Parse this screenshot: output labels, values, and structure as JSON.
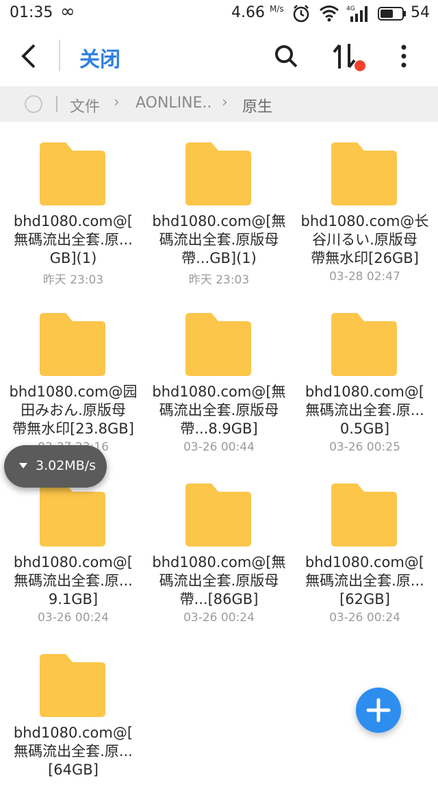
{
  "status_bar": {
    "time": "01:35",
    "speed": "4.66",
    "speed_unit": "M/s",
    "network": "4G",
    "battery": "54"
  },
  "toolbar": {
    "close_label": "关闭"
  },
  "breadcrumb": {
    "items": [
      "文件",
      "AONLINE..",
      "原生"
    ]
  },
  "folders": [
    {
      "name": "bhd1080.com@[\n無碼流出全套.原...\nGB](1)",
      "date": "昨天 23:03"
    },
    {
      "name": "bhd1080.com@[無\n碼流出全套.原版母\n帶...GB](1)",
      "date": "昨天 23:03"
    },
    {
      "name": "bhd1080.com@长\n谷川るい.原版母\n帶無水印[26GB]",
      "date": "03-28 02:47"
    },
    {
      "name": "bhd1080.com@园\n田みおん.原版母\n帶無水印[23.8GB]",
      "date": "03-27 23:16"
    },
    {
      "name": "bhd1080.com@[無\n碼流出全套.原版母\n帶...8.9GB]",
      "date": "03-26 00:44"
    },
    {
      "name": "bhd1080.com@[\n無碼流出全套.原...\n0.5GB]",
      "date": "03-26 00:25"
    },
    {
      "name": "bhd1080.com@[\n無碼流出全套.原...\n9.1GB]",
      "date": "03-26 00:24"
    },
    {
      "name": "bhd1080.com@[無\n碼流出全套.原版母\n帶...[86GB]",
      "date": "03-26 00:24"
    },
    {
      "name": "bhd1080.com@[\n無碼流出全套.原...\n[62GB]",
      "date": "03-26 00:24"
    },
    {
      "name": "bhd1080.com@[\n無碼流出全套.原...\n[64GB]",
      "date": ""
    }
  ],
  "download_speed": "3.02MB/s",
  "colors": {
    "accent": "#2d7fe0",
    "folder": "#fcc64a",
    "fab": "#2d8ef0",
    "badge": "#f2412c"
  }
}
